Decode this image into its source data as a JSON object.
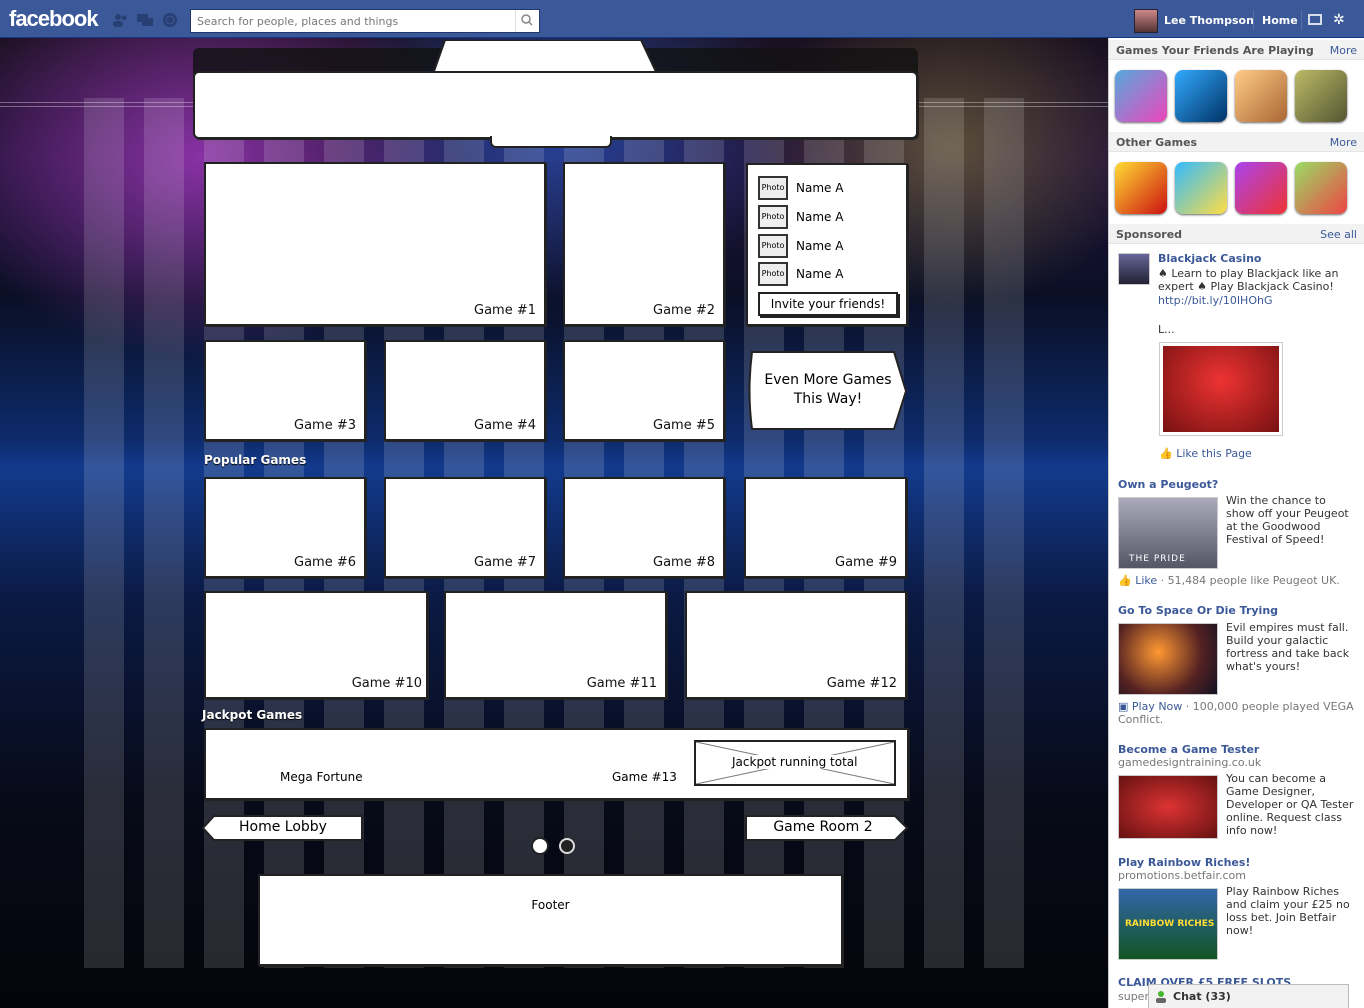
{
  "topbar": {
    "logo": "facebook",
    "search_placeholder": "Search for people, places and things",
    "user_name": "Lee Thompson",
    "home_label": "Home"
  },
  "app": {
    "games": {
      "g1": "Game #1",
      "g2": "Game #2",
      "g3": "Game #3",
      "g4": "Game #4",
      "g5": "Game #5",
      "g6": "Game #6",
      "g7": "Game #7",
      "g8": "Game #8",
      "g9": "Game #9",
      "g10": "Game #10",
      "g11": "Game #11",
      "g12": "Game #12",
      "g13": "Game #13"
    },
    "friends": [
      {
        "photo": "Photo",
        "name": "Name A"
      },
      {
        "photo": "Photo",
        "name": "Name A"
      },
      {
        "photo": "Photo",
        "name": "Name A"
      },
      {
        "photo": "Photo",
        "name": "Name A"
      }
    ],
    "invite_label": "Invite your friends!",
    "more_games_label": "Even More Games This Way!",
    "popular_title": "Popular Games",
    "jackpot_title": "Jackpot Games",
    "mega_fortune": "Mega Fortune",
    "jackpot_total": "Jackpot running total",
    "home_lobby": "Home Lobby",
    "game_room_2": "Game Room 2",
    "footer": "Footer"
  },
  "sidebar": {
    "friends_playing_title": "Games Your Friends Are Playing",
    "more1": "More",
    "other_games_title": "Other Games",
    "more2": "More",
    "sponsored": "Sponsored",
    "see_all": "See all",
    "ads": [
      {
        "title": "Blackjack Casino",
        "text": "♠ Learn to play Blackjack like an expert ♠ Play Blackjack Casino!",
        "link": "http://bit.ly/10IHOhG",
        "ellipsis": "L...",
        "action": "Like this Page"
      },
      {
        "title": "Own a Peugeot?",
        "text": "Win the chance to show off your Peugeot at the Goodwood Festival of Speed!",
        "img_caption": "THE PRIDE",
        "action": "Like",
        "social": " · 51,484 people like Peugeot UK."
      },
      {
        "title": "Go To Space Or Die Trying",
        "text": "Evil empires must fall. Build your galactic fortress and take back what's yours!",
        "action": "Play Now",
        "social": " · 100,000 people played VEGA Conflict."
      },
      {
        "title": "Become a Game Tester",
        "sub": "gamedesigntraining.co.uk",
        "text": "You can become a Game Designer, Developer or QA Tester online. Request class info now!"
      },
      {
        "title": "Play Rainbow Riches!",
        "sub": "promotions.betfair.com",
        "text": "Play Rainbow Riches and claim your £25 no loss bet. Join Betfair now!",
        "img_caption": "RAINBOW RICHES"
      },
      {
        "title": "CLAIM OVER £5 FREE SLOTS",
        "sub": "super"
      }
    ]
  },
  "chat": {
    "label": "Chat (33)"
  },
  "colors": {
    "fb_blue": "#3b5998",
    "link": "#3b5998"
  }
}
